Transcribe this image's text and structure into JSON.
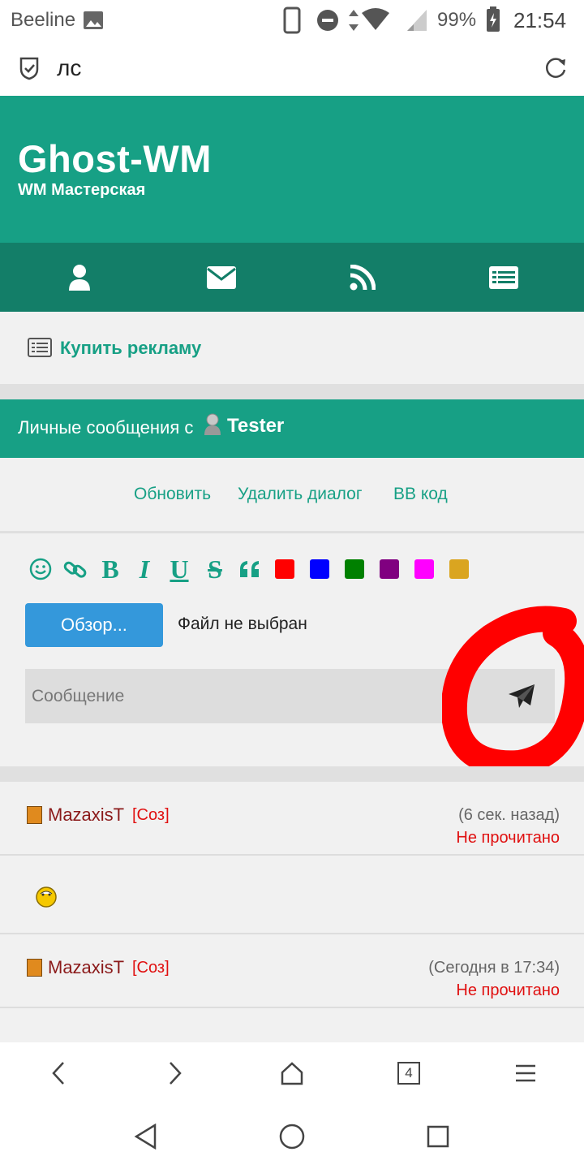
{
  "status_bar": {
    "carrier": "Beeline",
    "battery": "99%",
    "time": "21:54"
  },
  "url_bar": {
    "title": "лс"
  },
  "site": {
    "title": "Ghost-WM",
    "subtitle": "WM Мастерская"
  },
  "nav_icons": [
    "user-icon",
    "mail-icon",
    "rss-icon",
    "list-icon"
  ],
  "ad": {
    "label": "Купить рекламу"
  },
  "pm_header": {
    "text": "Личные сообщения с",
    "user": "Tester"
  },
  "actions": {
    "refresh": "Обновить",
    "delete": "Удалить диалог",
    "bbcode": "BB код"
  },
  "toolbar": {
    "colors": [
      "#ff0000",
      "#0000ff",
      "#008000",
      "#800080",
      "#ff00ff",
      "#daa520"
    ]
  },
  "composer": {
    "browse_label": "Обзор...",
    "file_status": "Файл не выбран",
    "message_placeholder": "Сообщение"
  },
  "messages": [
    {
      "author": "MazaxisT",
      "role": "[Соз]",
      "time": "(6 сек. назад)",
      "status": "Не прочитано"
    },
    {
      "author": "MazaxisT",
      "role": "[Соз]",
      "time": "(Сегодня в 17:34)",
      "status": "Не прочитано"
    }
  ],
  "browser_bar": {
    "tabs_count": "4"
  }
}
